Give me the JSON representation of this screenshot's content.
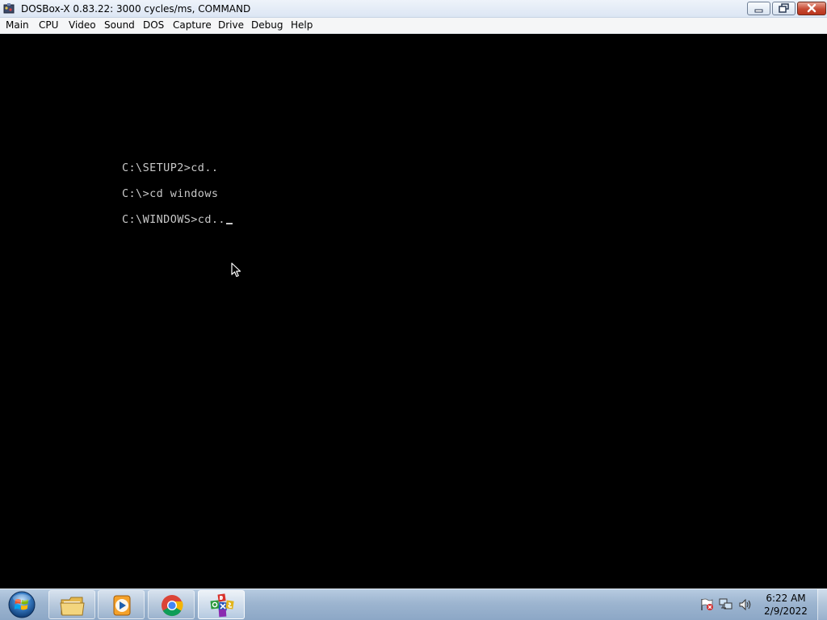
{
  "window": {
    "title": "DOSBox-X 0.83.22: 3000 cycles/ms, COMMAND",
    "icon": "dosbox-app-icon",
    "controls": [
      "minimize",
      "maximize",
      "close"
    ]
  },
  "menu": {
    "items": [
      {
        "label": "Main"
      },
      {
        "label": "CPU"
      },
      {
        "label": "Video"
      },
      {
        "label": "Sound"
      },
      {
        "label": "DOS"
      },
      {
        "label": "Capture"
      },
      {
        "label": "Drive"
      },
      {
        "label": "Debug"
      },
      {
        "label": "Help"
      }
    ]
  },
  "console": {
    "lines": [
      "C:\\SETUP2>cd..",
      "C:\\>cd windows",
      "C:\\WINDOWS>cd.."
    ],
    "text_color": "#c8c8c8",
    "background": "#000000"
  },
  "taskbar": {
    "start_icon": "windows-start-orb",
    "pinned": [
      {
        "name": "windows-explorer",
        "icon": "folder-icon"
      },
      {
        "name": "windows-media-player",
        "icon": "media-player-icon"
      },
      {
        "name": "google-chrome",
        "icon": "chrome-icon"
      },
      {
        "name": "dosbox-x",
        "icon": "dosbox-icon",
        "active": true
      }
    ],
    "tray_icons": [
      "action-center-icon",
      "network-icon",
      "volume-icon"
    ],
    "clock": {
      "time": "6:22 AM",
      "date": "2/9/2022"
    }
  }
}
